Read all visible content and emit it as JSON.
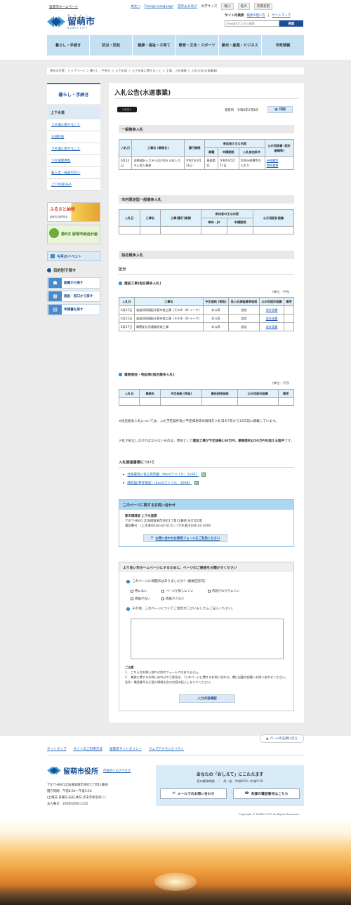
{
  "header": {
    "site_home": "留萌市ホームページ",
    "logo_ruby": "る も い し",
    "logo_jp": "留萌市",
    "logo_en": "RUMOI CITY",
    "util": {
      "home": "本文へ",
      "lang": "Foreign Language",
      "voice": "音声よみあげ",
      "textsize": "文字サイズ",
      "shrink": "縮小",
      "enlarge": "拡大",
      "bg": "背景変更"
    },
    "search_label": "サイト内検索",
    "search_help": "検索の使い方",
    "sitemap": "サイトマップ",
    "search_placeholder": "Googleカスタム検索",
    "search_button": "検索"
  },
  "gnav": [
    "暮らし・手続き",
    "防災・防犯",
    "健康・福祉・子育て",
    "教育・文化・スポーツ",
    "観光・産業・ビジネス",
    "市政情報"
  ],
  "breadcrumb": "現在の位置：トップページ ＞ 暮らし・手続き ＞ 上下水道 ＞ 上下水道に関すること ＞ 工事、入札情報 ＞ 入札公告(水道事業)",
  "sidebar": {
    "heading": "暮らし・手続き",
    "current": "上下水道",
    "items": [
      "上水道に関すること",
      "水道料金",
      "下水道に関すること",
      "下水道使用料",
      "転入出・転居の方へ",
      "上下水道Q&A"
    ],
    "banner1": "ふるさと納税",
    "banner1_sub": "留萌市応援寄附金",
    "banner2": "第6次 留萌市総合計画",
    "event": "今月のイベント",
    "purpose_title": "目的別で探す",
    "purpose": [
      "組織から探す",
      "施設・窓口から探す",
      "申請書を探す"
    ]
  },
  "main": {
    "title": "入札公告(水道事業)",
    "tweet": "ポスト",
    "updated": "更新日　令和6年5月8日",
    "print": "印刷",
    "general": {
      "heading": "一般競争入札",
      "headers": [
        "入札日",
        "工事名\n(業務名)",
        "履行期間",
        "参加者の主な内容",
        "業種",
        "申請期限",
        "入札参加条件",
        "公示用図書\n(設計書類等)"
      ],
      "row": [
        "6月14日",
        "自動検針システム及び見える化システム導入業務",
        "令和7年3月31日",
        "業務委託",
        "令和6年5月21日",
        "別添仕様書等のとおり",
        "仕様書等",
        "関係書類"
      ]
    },
    "local": {
      "heading": "市内限定型一般競争入札",
      "headers": [
        "入札日",
        "工事名",
        "工事(履行)期間",
        "参加者の主な内容",
        "単体・JV",
        "申請期限",
        "公示用設計図書"
      ]
    },
    "designated": {
      "heading": "指名競争入札",
      "section": "区分",
      "construction": "建設工事(指名競争入札)",
      "unit": "(単位：千円)",
      "headers": [
        "入札日",
        "工事名",
        "予定価格\n(税抜)",
        "低入札調査基準価格",
        "公示用設計図書",
        "備考"
      ],
      "rows": [
        [
          "6月12日",
          "道道見晴通配水管布設工事（その2）(D-イ～ア)",
          "非公表",
          "設定",
          "設計図書",
          ""
        ],
        [
          "6月12日",
          "道道見晴通配水管布設工事（その3）(D-イ～ウ)",
          "非公表",
          "設定",
          "設計図書",
          ""
        ],
        [
          "6月17日",
          "晴穂配水池通路改修工事",
          "非公表",
          "設定",
          "設計図書",
          ""
        ]
      ],
      "service": "業務委託・物品等(指名競争入札)",
      "unit2": "(単位：千円)",
      "headers2": [
        "入札日",
        "業務名",
        "予定価格\n(税抜)",
        "最低制限価格",
        "公示用設計図書",
        "備考"
      ]
    },
    "note1": "※指名競争入札については、入札予定案件及び予定価格等の情報を入札日の7日から15日前に掲載しています。",
    "note2a": "入札が成立しなければならないものは、原則として",
    "note2b": "建設工事が予定価格130万円、業務委託は50万円を超える案件",
    "note2c": "です。",
    "docs_heading": "入札関連書類について",
    "docs": [
      "仕様書等に係る質問書（Wordファイル：11KB）",
      "辞退届(参考様式)（Excelファイル：35KB）"
    ],
    "contact": {
      "heading": "このページに関するお問い合わせ",
      "dept": "都市環境部 上下水道課",
      "addr": "〒077-8601 北海道留萌市幸町1丁目11番地 分庁舎1階",
      "tel": "電話番号：(上水道)0164-42-5151／(下水道)0164-42-2049",
      "mail": "お問い合わせは専用フォームをご利用ください"
    },
    "survey": {
      "heading": "より良い市ホームページにするために、ページのご感想をお聞かせください",
      "q1": "このページに問題点はありましたか？(複数回答可)",
      "opts": [
        "特にない",
        "ページが探しにくい",
        "内容がわかりにくい",
        "情報が古い",
        "情報が少ない"
      ],
      "q2": "その他、このページについてご意見がございましたらご記入ください。",
      "note_title": "ご注意",
      "note1": "1.　こちらはお問い合わせ用のフォームではありません。",
      "note2": "2.　業務に関するお問い合わせやご意見は、「このページに関するお問い合わせ」欄に記載の部署へお問い合わせください。住所・電話番号など個人情報を含む内容は記入しないでください。",
      "confirm": "入力内容確認"
    }
  },
  "pagetop": "ページの先頭に戻る",
  "footer": {
    "nav": [
      "サイトマップ",
      "サイトのご利用方法",
      "留萌市サイトポリシー",
      "ウェブアクセシビリティ"
    ],
    "org": "留萌市役所",
    "access": "市役所へのアクセス",
    "addr": "〒077-8601北海道留萌市幸町1丁目11番地",
    "hours": "開庁時間：午前8:50～午後5:20",
    "closed": "(土曜日,日曜日,祝日,休日,年末年始を除く)",
    "corp": "法人番号：2000020012122",
    "box_title": "あなたの「おしえて」にこたえます",
    "box_sub": "窓口業務時間　／　月～金　午前8:50～午後5:20",
    "mail_btn": "メールでのお問い合わせ",
    "tel_btn": "各課の電話番号はこちら",
    "copyright": "Copyright © RUMOI CITY. All Rights Reserved."
  },
  "colors": {
    "brand": "#1b4f95",
    "nav_bg": "#c4e1f3",
    "page_bg": "#ebebeb"
  }
}
